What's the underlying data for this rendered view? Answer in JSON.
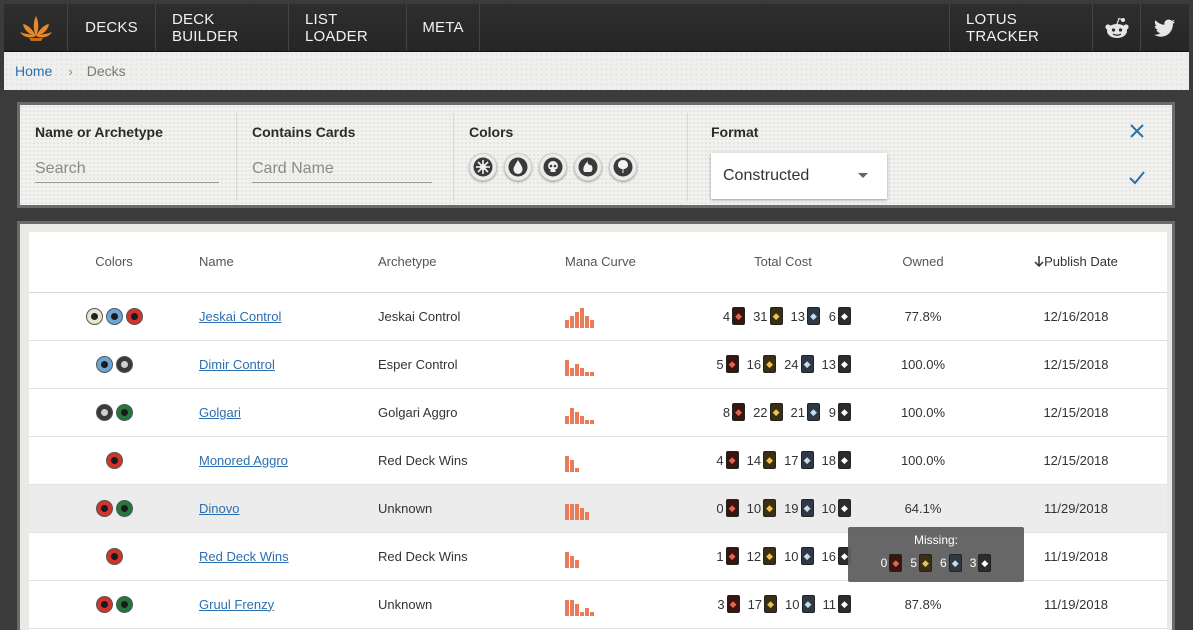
{
  "nav": {
    "logo_icon": "lotus-logo-icon",
    "items": [
      "DECKS",
      "DECK BUILDER",
      "LIST LOADER",
      "META"
    ],
    "right_item": "LOTUS TRACKER",
    "social_icons": [
      "reddit-icon",
      "twitter-icon"
    ]
  },
  "breadcrumb": {
    "home": "Home",
    "separator": "›",
    "current": "Decks"
  },
  "filters": {
    "name_label": "Name or Archetype",
    "name_placeholder": "Search",
    "cards_label": "Contains Cards",
    "cards_placeholder": "Card Name",
    "colors_label": "Colors",
    "color_buttons": [
      "white",
      "blue",
      "black",
      "red",
      "green"
    ],
    "format_label": "Format",
    "format_value": "Constructed",
    "clear_icon": "close-icon",
    "apply_icon": "check-icon"
  },
  "colors": {
    "white": "#e8e4cf",
    "blue": "#6aa7d8",
    "black": "#3a3a3a",
    "red": "#d0342c",
    "green": "#1f7a3c",
    "accent": "#2b6fb0",
    "curve": "#e97b57"
  },
  "table": {
    "headers": {
      "colors": "Colors",
      "name": "Name",
      "archetype": "Archetype",
      "mana_curve": "Mana Curve",
      "total_cost": "Total Cost",
      "owned": "Owned",
      "publish_date": "Publish Date"
    },
    "sort_icon": "arrow-down-icon",
    "rows": [
      {
        "colors": [
          "white",
          "blue",
          "red"
        ],
        "name": "Jeskai Control",
        "archetype": "Jeskai Control",
        "curve": [
          2,
          3,
          4,
          5,
          3,
          2
        ],
        "cost": [
          4,
          31,
          13,
          6
        ],
        "owned": "77.8%",
        "date": "12/16/2018"
      },
      {
        "colors": [
          "blue",
          "black"
        ],
        "name": "Dimir Control",
        "archetype": "Esper Control",
        "curve": [
          4,
          2,
          3,
          2,
          1,
          1
        ],
        "cost": [
          5,
          16,
          24,
          13
        ],
        "owned": "100.0%",
        "date": "12/15/2018"
      },
      {
        "colors": [
          "black",
          "green"
        ],
        "name": "Golgari",
        "archetype": "Golgari Aggro",
        "curve": [
          2,
          4,
          3,
          2,
          1,
          1
        ],
        "cost": [
          8,
          22,
          21,
          9
        ],
        "owned": "100.0%",
        "date": "12/15/2018"
      },
      {
        "colors": [
          "red"
        ],
        "name": "Monored Aggro",
        "archetype": "Red Deck Wins",
        "curve": [
          4,
          3,
          1,
          0,
          0,
          0
        ],
        "cost": [
          4,
          14,
          17,
          18
        ],
        "owned": "100.0%",
        "date": "12/15/2018"
      },
      {
        "colors": [
          "red",
          "green"
        ],
        "name": "Dinovo",
        "archetype": "Unknown",
        "curve": [
          4,
          4,
          4,
          3,
          2,
          0
        ],
        "cost": [
          0,
          10,
          19,
          10
        ],
        "owned": "64.1%",
        "date": "11/29/2018",
        "highlight": true
      },
      {
        "colors": [
          "red"
        ],
        "name": "Red Deck Wins",
        "archetype": "Red Deck Wins",
        "curve": [
          4,
          3,
          2,
          0,
          0,
          0
        ],
        "cost": [
          1,
          12,
          10,
          16
        ],
        "owned": "",
        "date": "11/19/2018"
      },
      {
        "colors": [
          "red",
          "green"
        ],
        "name": "Gruul Frenzy",
        "archetype": "Unknown",
        "curve": [
          4,
          4,
          3,
          1,
          2,
          1
        ],
        "cost": [
          3,
          17,
          10,
          11
        ],
        "owned": "87.8%",
        "date": "11/19/2018"
      }
    ]
  },
  "tooltip": {
    "title": "Missing:",
    "values": [
      0,
      5,
      6,
      3
    ]
  }
}
